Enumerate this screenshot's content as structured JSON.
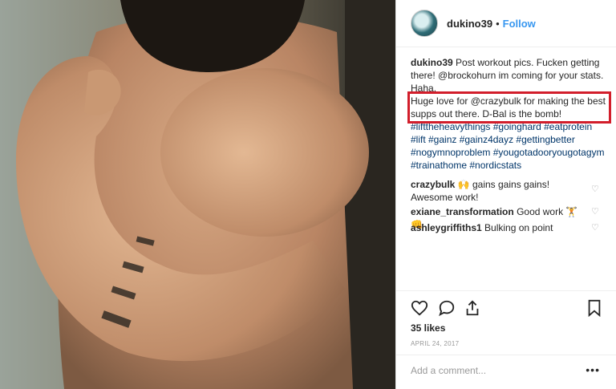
{
  "post": {
    "username": "dukino39",
    "separator": "•",
    "follow_label": "Follow",
    "caption_user": "dukino39",
    "caption_text": "Post workout pics. Fucken getting there! @brockohurn im coming for your stats. Haha.",
    "highlight_text": "Huge love for @crazybulk for making the best supps out there. D-Bal is the bomb!",
    "hashtags": "#lifttheheavythings #goinghard #eatprotein #lift #gainz #gainz4dayz #gettingbetter #nogymnoproblem #yougotadooryougotagym #trainathome #nordicstats",
    "likes": "35 likes",
    "date": "APRIL 24, 2017",
    "add_comment_placeholder": "Add a comment...",
    "more_label": "•••"
  },
  "comments": [
    {
      "user": "crazybulk",
      "text": "🙌 gains gains gains! Awesome work!"
    },
    {
      "user": "exiane_transformation",
      "text": "Good work 🏋👊"
    },
    {
      "user": "ashleygriffiths1",
      "text": "Bulking on point"
    }
  ],
  "icons": {
    "like": "heart-icon",
    "comment": "comment-icon",
    "share": "share-icon",
    "save": "bookmark-icon",
    "comment_like": "heart-icon"
  },
  "colors": {
    "link": "#3897f0",
    "highlight_box": "#d21e2b",
    "text": "#262626"
  }
}
